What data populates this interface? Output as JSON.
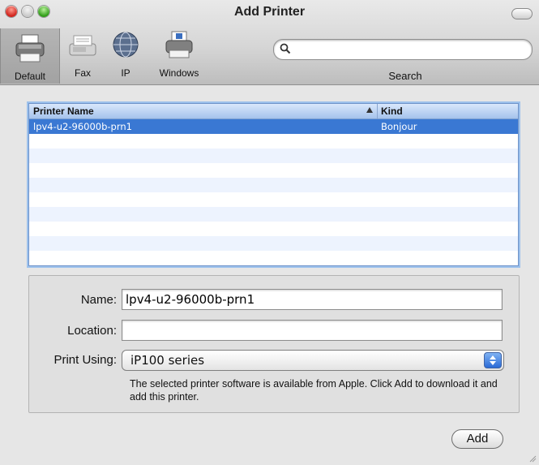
{
  "window": {
    "title": "Add Printer"
  },
  "toolbar": {
    "buttons": [
      {
        "label": "Default",
        "icon": "printer-icon",
        "selected": true
      },
      {
        "label": "Fax",
        "icon": "fax-icon"
      },
      {
        "label": "IP",
        "icon": "globe-icon"
      },
      {
        "label": "Windows",
        "icon": "windows-printer-icon"
      }
    ],
    "search": {
      "value": "",
      "placeholder": "",
      "label": "Search",
      "icon": "search-icon"
    }
  },
  "list": {
    "headers": {
      "name": "Printer Name",
      "kind": "Kind"
    },
    "rows": [
      {
        "name": "lpv4-u2-96000b-prn1",
        "kind": "Bonjour",
        "selected": true
      }
    ]
  },
  "details": {
    "name_label": "Name:",
    "name_value": "lpv4-u2-96000b-prn1",
    "location_label": "Location:",
    "location_value": "",
    "print_using_label": "Print Using:",
    "print_using_value": "iP100 series",
    "note": "The selected printer software is available from Apple. Click Add to download it and add this printer."
  },
  "actions": {
    "add_label": "Add"
  },
  "colors": {
    "selection": "#3a78d3",
    "alt_row": "#edf3fe"
  }
}
